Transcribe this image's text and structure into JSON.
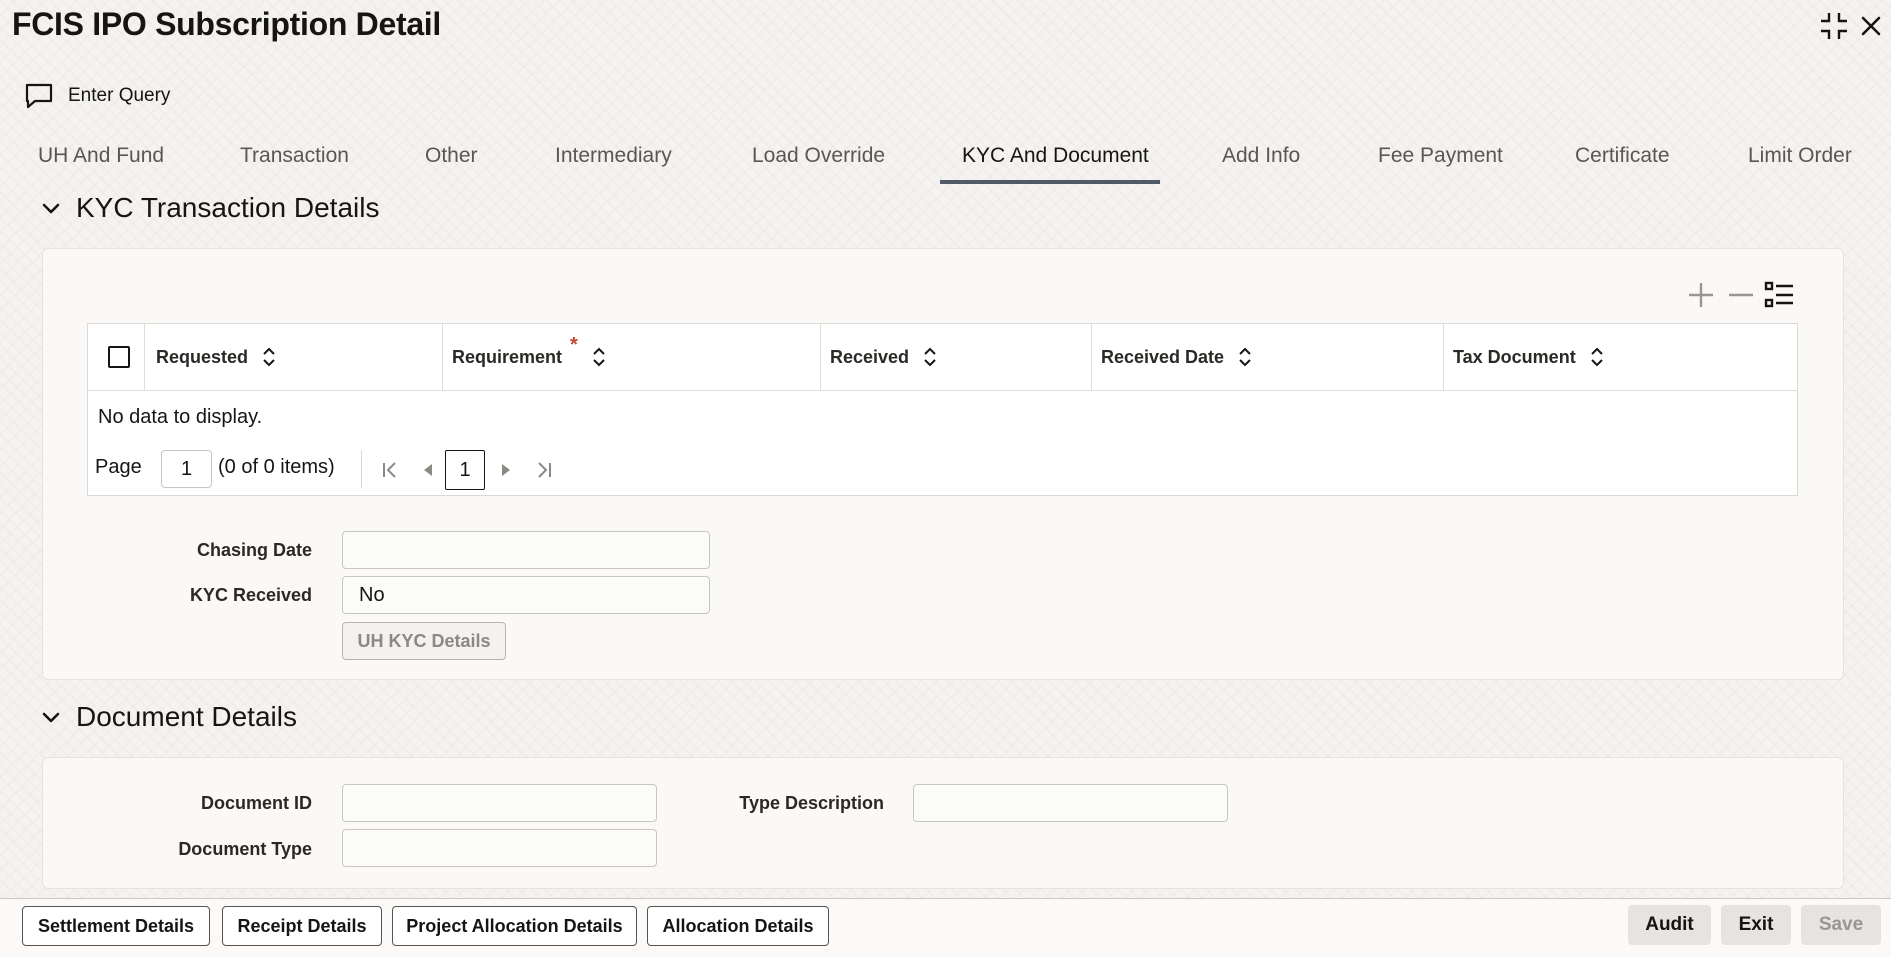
{
  "window": {
    "title": "FCIS IPO Subscription Detail"
  },
  "toolbar": {
    "enter_query_label": "Enter Query"
  },
  "tabs": [
    {
      "label": "UH And Fund"
    },
    {
      "label": "Transaction"
    },
    {
      "label": "Other"
    },
    {
      "label": "Intermediary"
    },
    {
      "label": "Load Override"
    },
    {
      "label": "KYC And Document",
      "active": true
    },
    {
      "label": "Add Info"
    },
    {
      "label": "Fee Payment"
    },
    {
      "label": "Certificate"
    },
    {
      "label": "Limit Order"
    }
  ],
  "kyc": {
    "section_title": "KYC Transaction Details",
    "grid": {
      "columns": [
        {
          "label": "Requested"
        },
        {
          "label": "Requirement",
          "required_mark": "*"
        },
        {
          "label": "Received"
        },
        {
          "label": "Received Date"
        },
        {
          "label": "Tax Document"
        }
      ],
      "empty_text": "No data to display.",
      "pager": {
        "page_label": "Page",
        "page_value": "1",
        "items_text": "(0 of 0 items)",
        "current_page": "1"
      }
    },
    "chasing_date_label": "Chasing Date",
    "chasing_date_value": "",
    "kyc_received_label": "KYC Received",
    "kyc_received_value": "No",
    "uh_kyc_button": "UH KYC Details"
  },
  "documents": {
    "section_title": "Document Details",
    "document_id_label": "Document ID",
    "document_id_value": "",
    "document_type_label": "Document Type",
    "document_type_value": "",
    "type_description_label": "Type Description",
    "type_description_value": ""
  },
  "footer": {
    "left_buttons": [
      {
        "label": "Settlement Details"
      },
      {
        "label": "Receipt Details"
      },
      {
        "label": "Project Allocation Details"
      },
      {
        "label": "Allocation Details"
      }
    ],
    "audit_label": "Audit",
    "exit_label": "Exit",
    "save_label": "Save"
  },
  "colors": {
    "accent_underline": "#4f5a66",
    "required_mark": "#c74634"
  }
}
